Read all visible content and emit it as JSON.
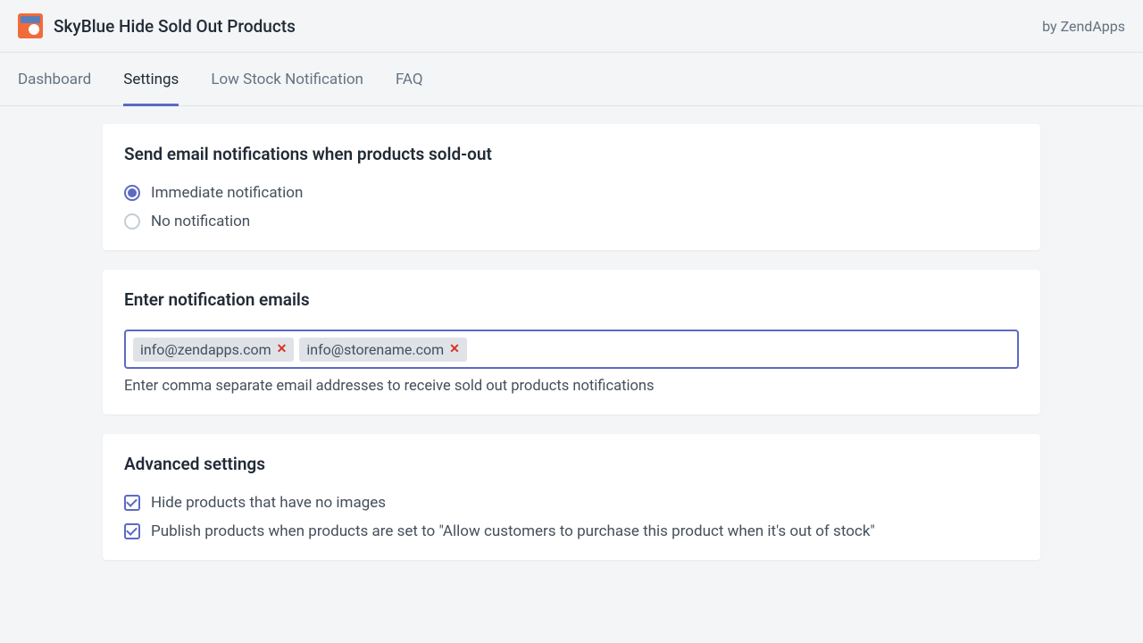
{
  "header": {
    "app_title": "SkyBlue Hide Sold Out Products",
    "byline": "by ZendApps"
  },
  "tabs": [
    {
      "label": "Dashboard",
      "active": false
    },
    {
      "label": "Settings",
      "active": true
    },
    {
      "label": "Low Stock Notification",
      "active": false
    },
    {
      "label": "FAQ",
      "active": false
    }
  ],
  "notification_card": {
    "title": "Send email notifications when products sold-out",
    "options": [
      {
        "label": "Immediate notification",
        "selected": true
      },
      {
        "label": "No notification",
        "selected": false
      }
    ]
  },
  "emails_card": {
    "title": "Enter notification emails",
    "tags": [
      "info@zendapps.com",
      "info@storename.com"
    ],
    "helper": "Enter comma separate email addresses to receive sold out products notifications"
  },
  "advanced_card": {
    "title": "Advanced settings",
    "options": [
      {
        "label": "Hide products that have no images",
        "checked": true
      },
      {
        "label": "Publish products when products are set to \"Allow customers to purchase this product when it's out of stock\"",
        "checked": true
      }
    ]
  }
}
